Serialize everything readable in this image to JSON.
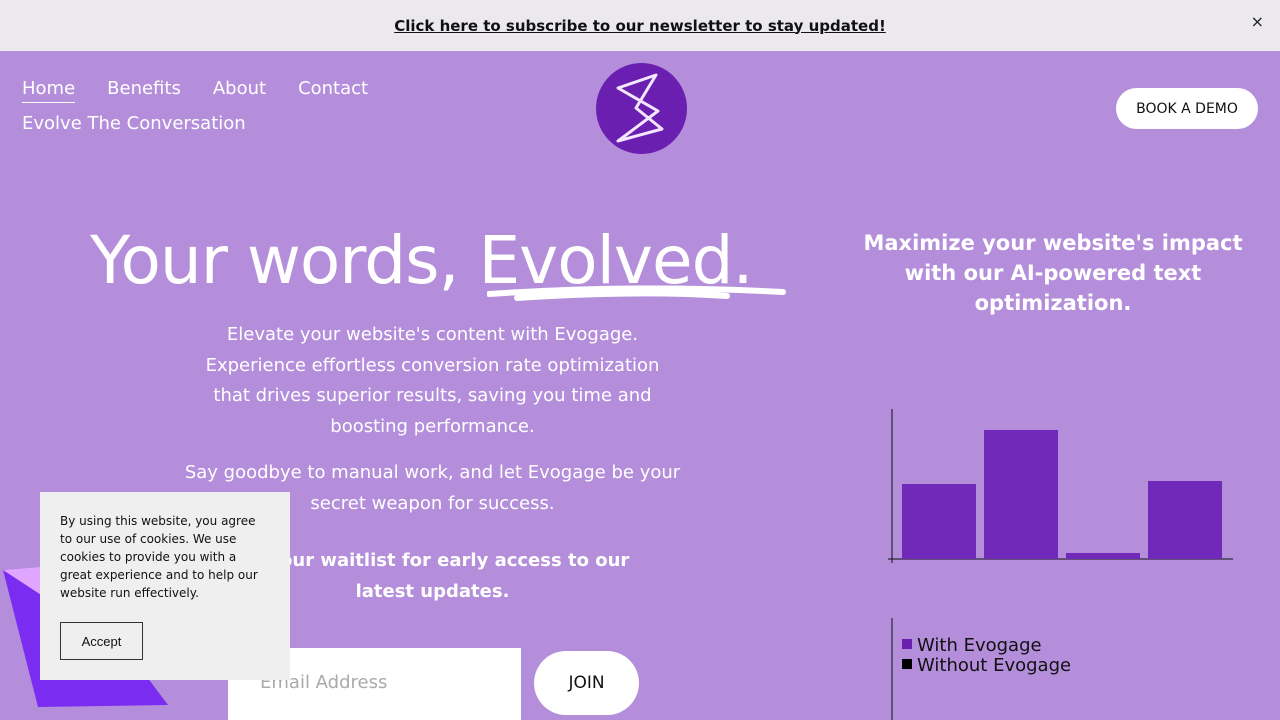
{
  "banner": {
    "text": "Click here to subscribe to our newsletter to stay updated!",
    "close": "×"
  },
  "nav": {
    "items": [
      "Home",
      "Benefits",
      "About",
      "Contact",
      "Evolve The Conversation"
    ]
  },
  "header": {
    "cta": "BOOK A DEMO"
  },
  "hero": {
    "title_a": "Your words, ",
    "title_b": "Evolved.",
    "p1": "Elevate your website's content with Evogage. Experience effortless conversion rate optimization that drives superior results, saving you time and boosting performance.",
    "p2": "Say goodbye to manual work, and let Evogage be your secret weapon for success.",
    "p3": "Join our waitlist for early access to our latest updates.",
    "email_placeholder": "Email Address",
    "join": "JOIN"
  },
  "side": {
    "heading": "Maximize your website's impact with our AI-powered text optimization."
  },
  "cookie": {
    "text": "By using this website, you agree to our use of cookies. We use cookies to provide you with a great experience and to help our website run effectively.",
    "accept": "Accept"
  },
  "chart_data": {
    "type": "bar",
    "values": [
      50,
      86,
      4,
      52
    ],
    "ylim": [
      0,
      100
    ],
    "color": "#7029b8",
    "legend": [
      {
        "name": "With Evogage",
        "color": "#6a1fb0"
      },
      {
        "name": "Without Evogage",
        "color": "#000000"
      }
    ]
  }
}
